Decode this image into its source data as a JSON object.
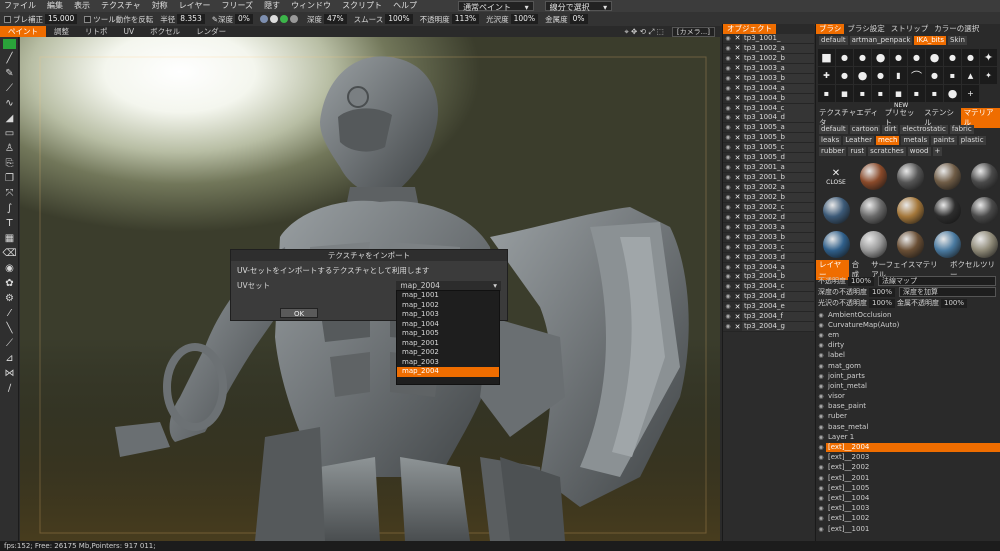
{
  "menubar": {
    "items": [
      "ファイル",
      "編集",
      "表示",
      "テクスチャ",
      "対称",
      "レイヤー",
      "フリーズ",
      "隠す",
      "ウィンドウ",
      "スクリプト",
      "ヘルプ"
    ]
  },
  "toolbar": {
    "smoothing_label": "ブレ補正",
    "smoothing_value": "15.000",
    "invert_label": "ツール動作を反転",
    "radius_label": "半径",
    "radius_value": "8.353",
    "depth_label": "深度",
    "depth_value": "0%",
    "depth2_label": "深度",
    "depth2_value": "47%",
    "smooth_label": "スムース",
    "smooth_value": "100%",
    "opacity_label": "不透明度",
    "opacity_value": "113%",
    "gloss_label": "光沢度",
    "gloss_value": "100%",
    "metal_label": "金属度",
    "metal_value": "0%",
    "paint_mode": "通常ペイント",
    "select_mode": "線分で選択"
  },
  "tabs": [
    "ペイント",
    "調整",
    "リトポ",
    "UV",
    "ボクセル",
    "レンダー"
  ],
  "active_tab": "ペイント",
  "camera": "[カメラ...]",
  "status": "fps:152;   Free: 26175 Mb,Pointers: 917 011;",
  "dialog": {
    "title": "テクスチャをインポート",
    "message": "UV-セットをインポートするテクスチャとして利用します",
    "uvset_label": "UVセット",
    "uvset_value": "map_2004",
    "ok_label": "OK"
  },
  "dropdown_options": [
    "map_1001",
    "map_1002",
    "map_1003",
    "map_1004",
    "map_1005",
    "map_2001",
    "map_2002",
    "map_2003",
    "map_2004"
  ],
  "dropdown_selected": "map_2004",
  "objects": {
    "header": "オブジェクト",
    "items": [
      "tp3_1001_",
      "tp3_1002_a",
      "tp3_1002_b",
      "tp3_1003_a",
      "tp3_1003_b",
      "tp3_1004_a",
      "tp3_1004_b",
      "tp3_1004_c",
      "tp3_1004_d",
      "tp3_1005_a",
      "tp3_1005_b",
      "tp3_1005_c",
      "tp3_1005_d",
      "tp3_2001_a",
      "tp3_2001_b",
      "tp3_2002_a",
      "tp3_2002_b",
      "tp3_2002_c",
      "tp3_2002_d",
      "tp3_2003_a",
      "tp3_2003_b",
      "tp3_2003_c",
      "tp3_2003_d",
      "tp3_2004_a",
      "tp3_2004_b",
      "tp3_2004_c",
      "tp3_2004_d",
      "tp3_2004_e",
      "tp3_2004_f",
      "tp3_2004_g"
    ]
  },
  "brush_panel": {
    "tabs": [
      "ブラシ",
      "ブラシ設定",
      "ストリップ",
      "カラーの選択"
    ],
    "subtabs": [
      "default",
      "artman_penpack",
      "IKA_bits",
      "Skin"
    ],
    "active_subtab": "IKA_bits",
    "new_label": "NEW"
  },
  "material_panel": {
    "tabs": [
      "テクスチャエディタ",
      "プリセット",
      "ステンシル",
      "マテリアル"
    ],
    "active_tab": "マテリアル",
    "subtabs": [
      "default",
      "cartoon",
      "dirt",
      "electrostatic",
      "fabric",
      "leaks",
      "Leather",
      "mech",
      "metals",
      "paints",
      "plastic",
      "rubber",
      "rust",
      "scratches",
      "wood",
      "+"
    ],
    "active_subtab": "mech",
    "close_label": "CLOSE"
  },
  "layer_panel": {
    "tabs": [
      "レイヤー",
      "合成",
      "サーフェイスマテリアル",
      "ボクセルツリー"
    ],
    "active_tab": "レイヤー",
    "opacity_label": "不透明度",
    "opacity_value": "100%",
    "blend_mode": "法線マップ",
    "depth_opacity_label": "深度の不透明度",
    "depth_opacity_value": "100%",
    "depth_mode": "深度を加算",
    "gloss_opacity_label": "光沢の不透明度",
    "gloss_opacity_value": "100%",
    "metal_opacity_label": "金属不透明度",
    "metal_opacity_value": "100%",
    "layers": [
      "AmbientOcclusion",
      "CurvatureMap(Auto)",
      "em",
      "dirty",
      "label",
      "mat_gom",
      "joint_parts",
      "joint_metal",
      "visor",
      "base_paint",
      "ruber",
      "base_metal",
      "Layer 1",
      "[ext]__2004",
      "[ext]__2003",
      "[ext]__2002",
      "[ext]__2001",
      "[ext]__1005",
      "[ext]__1004",
      "[ext]__1003",
      "[ext]__1002",
      "[ext]__1001"
    ],
    "active_layer": "[ext]__2004"
  },
  "colors": {
    "accent": "#ef6d00",
    "primary_swatch": "#2aa33a"
  }
}
